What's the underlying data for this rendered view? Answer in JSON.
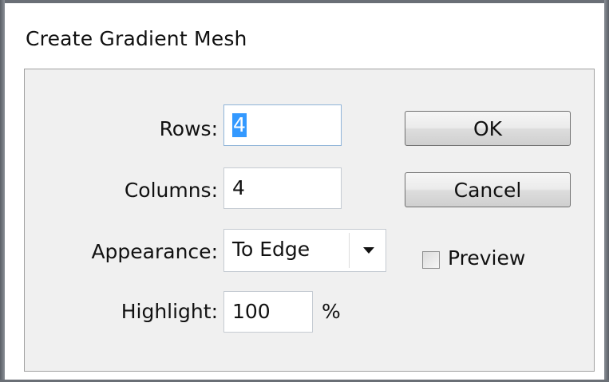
{
  "dialog": {
    "title": "Create Gradient Mesh"
  },
  "fields": {
    "rows": {
      "label": "Rows:",
      "value": "4"
    },
    "columns": {
      "label": "Columns:",
      "value": "4"
    },
    "appearance": {
      "label": "Appearance:",
      "selected": "To Edge"
    },
    "highlight": {
      "label": "Highlight:",
      "value": "100",
      "unit": "%"
    }
  },
  "buttons": {
    "ok_label": "OK",
    "cancel_label": "Cancel"
  },
  "preview": {
    "label": "Preview",
    "checked": false
  },
  "icons": {
    "dropdown": "chevron-down-icon",
    "checkbox": "checkbox-unchecked-icon"
  },
  "colors": {
    "selection": "#3399ff",
    "panel_bg": "#f0f0f0"
  }
}
